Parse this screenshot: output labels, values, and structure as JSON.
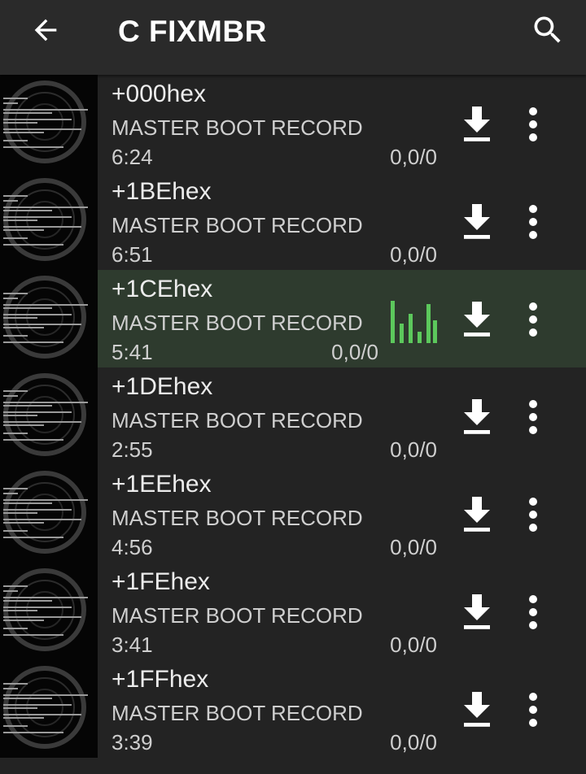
{
  "header": {
    "title": "C FIXMBR",
    "back_icon": "arrow-back-icon",
    "search_icon": "search-icon"
  },
  "colors": {
    "background": "#202020",
    "toolbar": "#2a2a2a",
    "playing_row": "#2e3b2e",
    "equalizer": "#5cc85c",
    "text_primary": "#ececec",
    "text_secondary": "#cfcfcf"
  },
  "tracks": [
    {
      "title": "+000hex",
      "artist": "MASTER BOOT RECORD",
      "duration": "6:24",
      "stats": "0,0/0",
      "playing": false
    },
    {
      "title": "+1BEhex",
      "artist": "MASTER BOOT RECORD",
      "duration": "6:51",
      "stats": "0,0/0",
      "playing": false
    },
    {
      "title": "+1CEhex",
      "artist": "MASTER BOOT RECORD",
      "duration": "5:41",
      "stats": "0,0/0",
      "playing": true
    },
    {
      "title": "+1DEhex",
      "artist": "MASTER BOOT RECORD",
      "duration": "2:55",
      "stats": "0,0/0",
      "playing": false
    },
    {
      "title": "+1EEhex",
      "artist": "MASTER BOOT RECORD",
      "duration": "4:56",
      "stats": "0,0/0",
      "playing": false
    },
    {
      "title": "+1FEhex",
      "artist": "MASTER BOOT RECORD",
      "duration": "3:41",
      "stats": "0,0/0",
      "playing": false
    },
    {
      "title": "+1FFhex",
      "artist": "MASTER BOOT RECORD",
      "duration": "3:39",
      "stats": "0,0/0",
      "playing": false
    }
  ],
  "row_icons": {
    "download": "download-icon",
    "more": "more-vert-icon",
    "equalizer": "equalizer-icon",
    "thumbnail": "album-art-thumbnail"
  }
}
